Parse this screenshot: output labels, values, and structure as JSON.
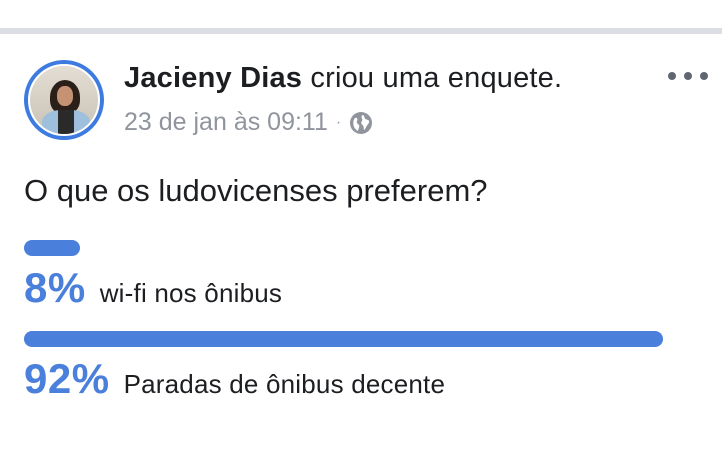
{
  "post": {
    "author": "Jacieny Dias",
    "action": " criou uma enquete.",
    "timestamp": "23 de jan às 09:11",
    "separator": "·",
    "privacy_icon": "globe-icon",
    "more_icon": "more-options-icon"
  },
  "poll": {
    "question": "O que os ludovicenses preferem?",
    "options": [
      {
        "percent_label": "8%",
        "label": "wi-fi nos ônibus",
        "value": 8
      },
      {
        "percent_label": "92%",
        "label": "Paradas de ônibus decente",
        "value": 92
      }
    ]
  },
  "colors": {
    "accent": "#4a7fdb",
    "text": "#1c1e21",
    "meta": "#90949c"
  }
}
